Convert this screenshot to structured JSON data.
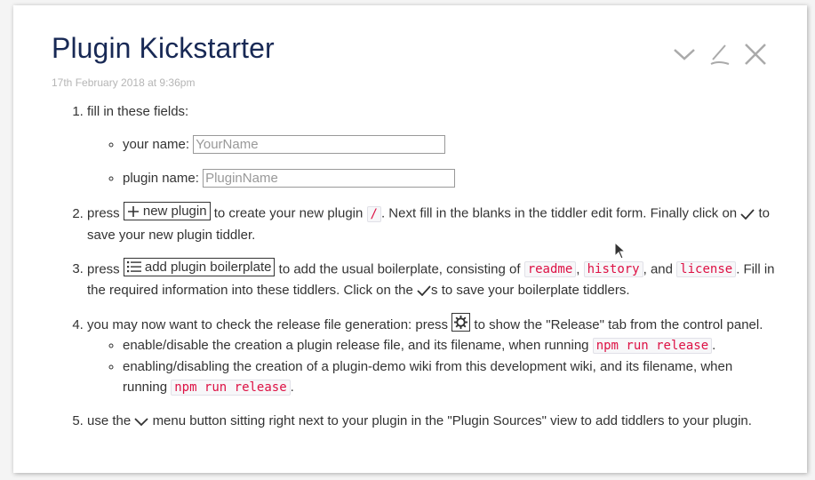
{
  "tiddler": {
    "title": "Plugin Kickstarter",
    "subtitle": "17th February 2018 at 9:36pm",
    "controls": [
      "chevron-down-icon",
      "edit-icon",
      "close-icon"
    ]
  },
  "steps": {
    "s1": {
      "text": "fill in these fields:",
      "name_label": "your name:",
      "name_placeholder": "YourName",
      "plugin_label": "plugin name:",
      "plugin_placeholder": "PluginName"
    },
    "s2": {
      "press": "press",
      "button_label": "new plugin",
      "t1": "to create your new plugin",
      "code": "/",
      "t2": ". Next fill in the blanks in the tiddler edit form. Finally click on",
      "t3": "to save your new plugin tiddler."
    },
    "s3": {
      "press": "press",
      "button_label": "add plugin boilerplate",
      "t1": "to add the usual boilerplate, consisting of",
      "c1": "readme",
      "sep1": ",",
      "c2": "history",
      "sep2": ", and",
      "c3": "license",
      "t2": ". Fill in the required information into these tiddlers. Click on the",
      "t3": "s to save your boilerplate tiddlers."
    },
    "s4": {
      "t1": "you may now want to check the release file generation: press",
      "t2": "to show the \"Release\" tab from the control panel.",
      "o1_text": "enable/disable the creation a plugin release file, and its filename, when running",
      "o1_code": "npm run release",
      "o1_end": ".",
      "o2_text": "enabling/disabling the creation of a plugin-demo wiki from this development wiki, and its filename, when running",
      "o2_code": "npm run release",
      "o2_end": "."
    },
    "s5": {
      "t1": "use the",
      "t2": "menu button sitting right next to your plugin in the \"Plugin Sources\" view to add tiddlers to your plugin."
    }
  },
  "colors": {
    "title": "#182955",
    "subtitle": "#b5b5b5",
    "code": "#dd1144",
    "controls": "#aaaaaa"
  }
}
